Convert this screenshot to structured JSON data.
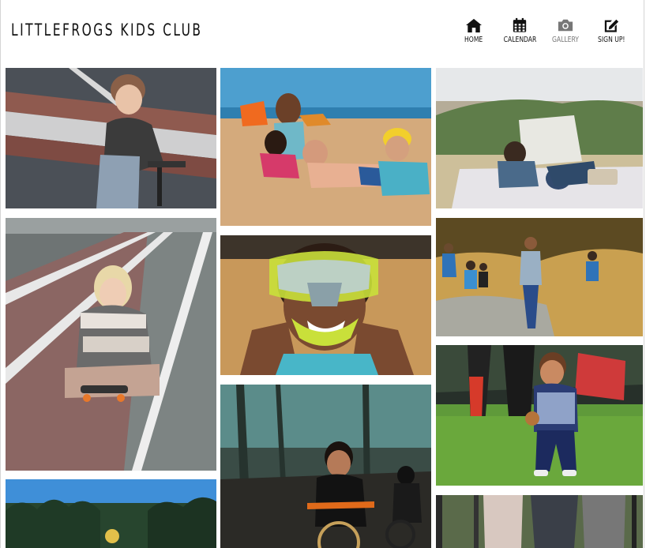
{
  "brand": {
    "title": "LITTLEFROGS KIDS CLUB"
  },
  "nav": {
    "home": {
      "label": "HOME",
      "icon": "home-icon"
    },
    "calendar": {
      "label": "CALENDAR",
      "icon": "calendar-icon"
    },
    "gallery": {
      "label": "GALLERY",
      "icon": "camera-icon"
    },
    "signup": {
      "label": "SIGN UP!",
      "icon": "edit-icon"
    }
  },
  "colors": {
    "text": "#111111",
    "muted": "#777777",
    "background": "#ffffff"
  }
}
